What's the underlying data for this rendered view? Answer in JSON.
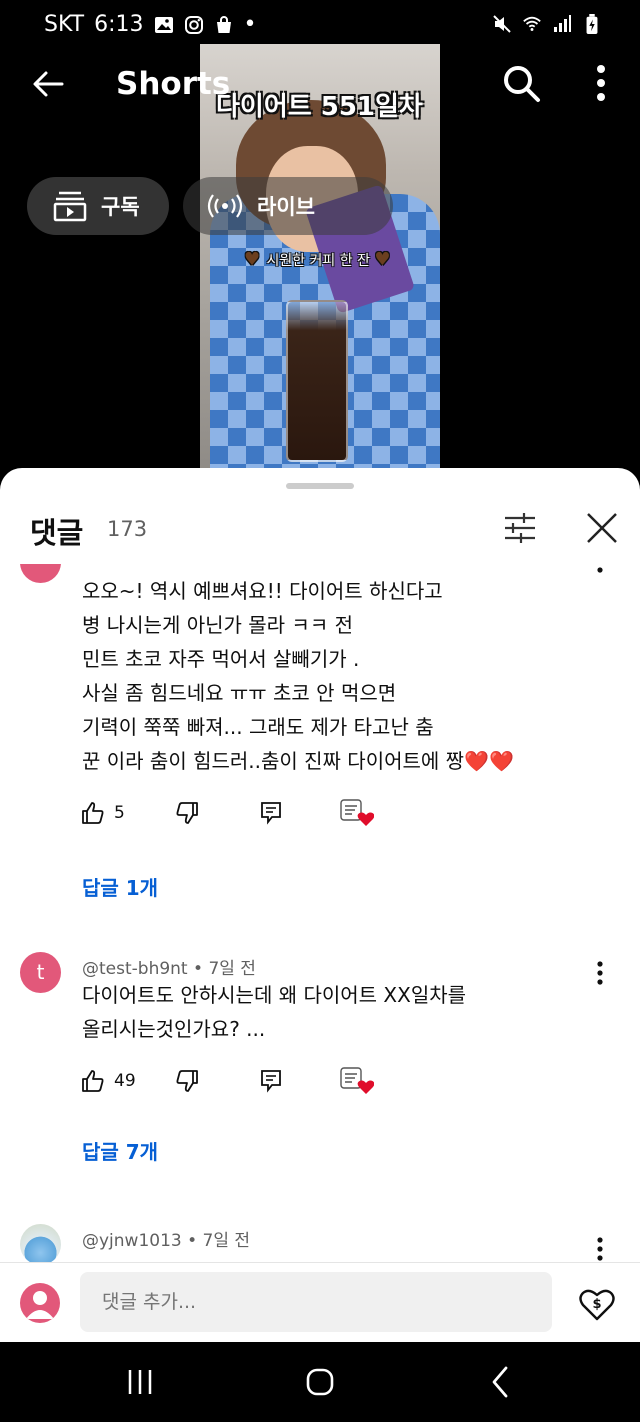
{
  "status_bar": {
    "carrier": "SKT",
    "time": "6:13",
    "dot": "•",
    "left_icons": [
      "gallery-icon",
      "instagram-icon",
      "shopping-bag-icon"
    ],
    "right_icons": [
      "mute-icon",
      "wifi-icon",
      "signal-icon",
      "battery-icon"
    ]
  },
  "app_bar": {
    "title": "Shorts",
    "icons": [
      "back-arrow-icon",
      "search-icon",
      "more-vert-icon"
    ]
  },
  "video": {
    "overlay_title": "다이어트 551일차",
    "caption": "시원한 커피 한 잔"
  },
  "pills": {
    "subscribe_label": "구독",
    "live_label": "라이브"
  },
  "comments_header": {
    "title": "댓글",
    "count": "173"
  },
  "comments": [
    {
      "avatar_color": "#e2587a",
      "text": "오오~! 역시 예쁘셔요!! 다이어트 하신다고\n병 나시는게 아닌가 몰라 ㅋㅋ 전\n민트 초코 자주 먹어서 살빼기가 .\n사실 좀 힘드네요 ㅠㅠ 초코 안 먹으면\n기력이 쭉쭉 빠져... 그래도 제가 타고난 춤\n꾼 이라 춤이 힘드러..춤이 진짜 다이어트에 짱❤️❤️",
      "likes": "5",
      "replies": "답글 1개"
    },
    {
      "avatar_letter": "t",
      "avatar_color": "#e2587a",
      "author": "@test-bh9nt • 7일 전",
      "text": "다이어트도 안하시는데 왜 다이어트 XX일차를\n올리시는것인가요? ...",
      "likes": "49",
      "replies": "답글 7개"
    },
    {
      "author": "@yjnw1013 • 7일 전"
    }
  ],
  "input_bar": {
    "placeholder": "댓글 추가..."
  },
  "nav_bar": {
    "icons": [
      "recent-apps-icon",
      "home-icon",
      "back-icon"
    ]
  },
  "colors": {
    "link_blue": "#065fd4",
    "heart_red": "#e00d2b",
    "sheet_bg": "#ffffff"
  }
}
